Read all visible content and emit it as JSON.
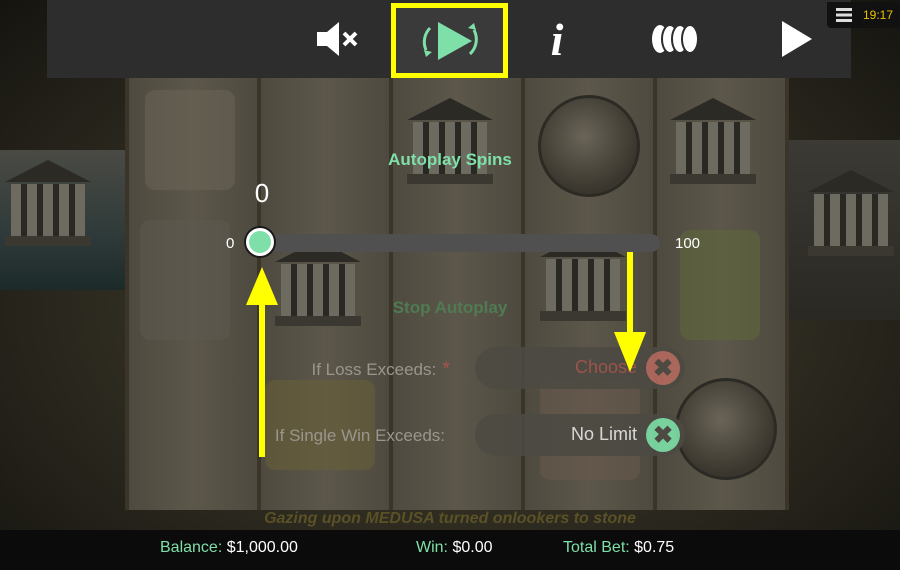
{
  "topbar": {
    "clock": "19:17",
    "buttons": {
      "mute": "mute-icon",
      "autoplay": "autoplay-icon",
      "info": "i",
      "bet": "coins-icon",
      "spin": "play-icon"
    }
  },
  "autoplay": {
    "title": "Autoplay Spins",
    "value": "0",
    "min": "0",
    "max": "100",
    "level": 0
  },
  "stop_autoplay": {
    "title": "Stop Autoplay",
    "loss_label": "If Loss Exceeds:",
    "loss_required": "*",
    "loss_value": "Choose",
    "single_win_label": "If Single Win Exceeds:",
    "single_win_value": "No Limit",
    "clear_symbol": "✖"
  },
  "banner": "Gazing upon MEDUSA turned onlookers to stone",
  "footer": {
    "balance_label": "Balance:",
    "balance_value": "$1,000.00",
    "win_label": "Win:",
    "win_value": "$0.00",
    "bet_label": "Total Bet:",
    "bet_value": "$0.75"
  },
  "colors": {
    "accent": "#7ee0a8",
    "highlight": "#ffff00",
    "clock": "#e8c400",
    "clear_loss": "#a4544a"
  }
}
